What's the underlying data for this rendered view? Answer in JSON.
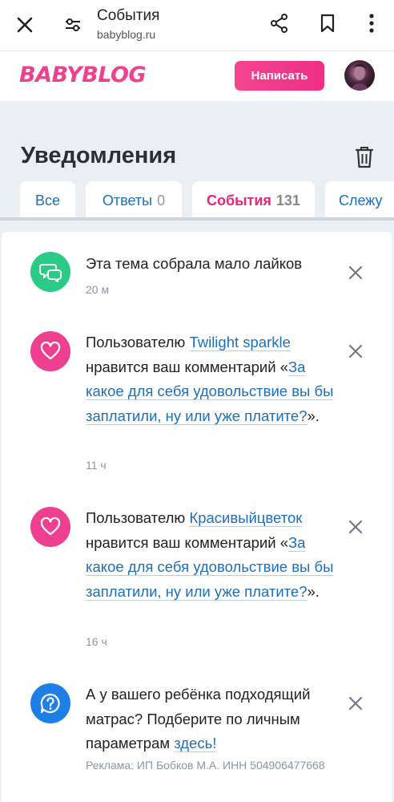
{
  "browser": {
    "title": "События",
    "url": "babyblog.ru"
  },
  "site": {
    "logo": "BABYBLOG",
    "write_button": "Написать",
    "brand_color": "#f0418f"
  },
  "page": {
    "title": "Уведомления",
    "tabs": [
      {
        "label": "Все",
        "count": ""
      },
      {
        "label": "Ответы",
        "count": "0"
      },
      {
        "label": "События",
        "count": "131",
        "active": true
      },
      {
        "label": "Слежу",
        "count": ""
      }
    ]
  },
  "notifications": [
    {
      "icon": "chat-bubbles-icon",
      "color": "#2bcb85",
      "text": "Эта тема собрала мало лайков",
      "time": "20 м"
    },
    {
      "icon": "heart-icon",
      "color": "#ee3f91",
      "prefix": "Пользователю ",
      "user": "Twilight sparkle",
      "middle": " нравится ваш комментарий «",
      "link": "За какое для себя удовольствие вы бы заплатили, ну или уже платите?",
      "suffix": "».",
      "time": "11 ч"
    },
    {
      "icon": "heart-icon",
      "color": "#ee3f91",
      "prefix": "Пользователю ",
      "user": "Красивыйцветок",
      "middle": " нравится ваш комментарий «",
      "link": "За какое для себя удовольствие вы бы заплатили, ну или уже платите?",
      "suffix": "».",
      "time": "16 ч"
    },
    {
      "icon": "question-bubble-icon",
      "color": "#1e7fe7",
      "text": "А у вашего ребёнка подходящий матрас? Подберите по личным параметрам ",
      "link": "здесь!",
      "ad": "Реклама: ИП Бобков М.А. ИНН 504906477668"
    }
  ]
}
